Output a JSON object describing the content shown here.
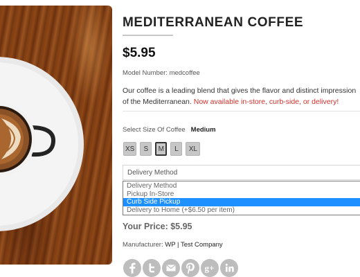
{
  "product": {
    "title": "MEDITERRANEAN COFFEE",
    "price": "$5.95",
    "model_label": "Model Number: medcoffee",
    "description_text": "Our coffee is a leading blend that gives the flavor and distinct impression of the Mediterranean. ",
    "availability_text": "Now available in-store, curb-side, or delivery!",
    "image_alt": "Coffee cup with latte art on a saucer"
  },
  "size": {
    "label": "Select Size Of Coffee",
    "selected_value": "Medium",
    "options": [
      "XS",
      "S",
      "M",
      "L",
      "XL"
    ],
    "selected_index": 2
  },
  "delivery": {
    "current_value": "Delivery Method",
    "options": [
      "Delivery Method",
      "Pickup In-Store",
      "Curb Side Pickup",
      "Delivery to Home (+$6.50 per item)"
    ],
    "highlighted_index": 2
  },
  "your_price": "Your Price: $5.95",
  "manufacturer": {
    "label": "Manufacturer: ",
    "value": "WP | Test Company"
  },
  "social": [
    "facebook-icon",
    "twitter-icon",
    "email-icon",
    "pinterest-icon",
    "google-plus-icon",
    "linkedin-icon"
  ],
  "colors": {
    "availability": "#d0302a",
    "highlight": "#1e90ff",
    "size_button": "#c7c7c7",
    "social_icon": "#bdbdbd"
  }
}
